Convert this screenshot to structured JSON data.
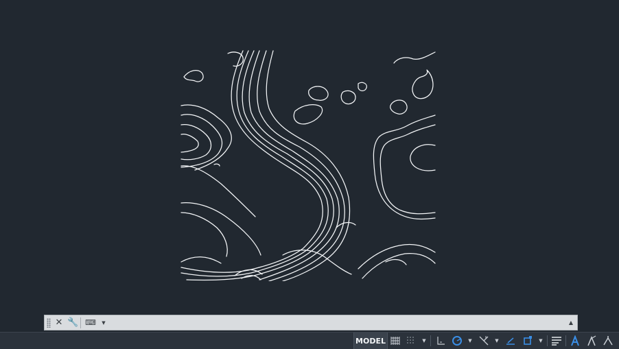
{
  "command_line": {
    "input_value": "",
    "placeholder": "",
    "close_icon": "close-icon",
    "customize_icon": "wrench-icon",
    "prompt_icon": "command-prompt-icon",
    "scroll_icon": "caret-up-icon"
  },
  "status_bar": {
    "model_label": "MODEL",
    "icons": [
      "grid-icon",
      "snap-grid-icon",
      "infer-constraints-icon",
      "polar-tracking-icon",
      "ortho-icon",
      "isodraft-icon",
      "object-snap-icon",
      "lineweight-icon",
      "annotation-scale-icon",
      "annotation-visibility-icon",
      "autoscale-icon"
    ]
  },
  "colors": {
    "canvas_background": "#212830",
    "contour_stroke": "#f4f6f8",
    "status_accent": "#3a8ee6"
  }
}
